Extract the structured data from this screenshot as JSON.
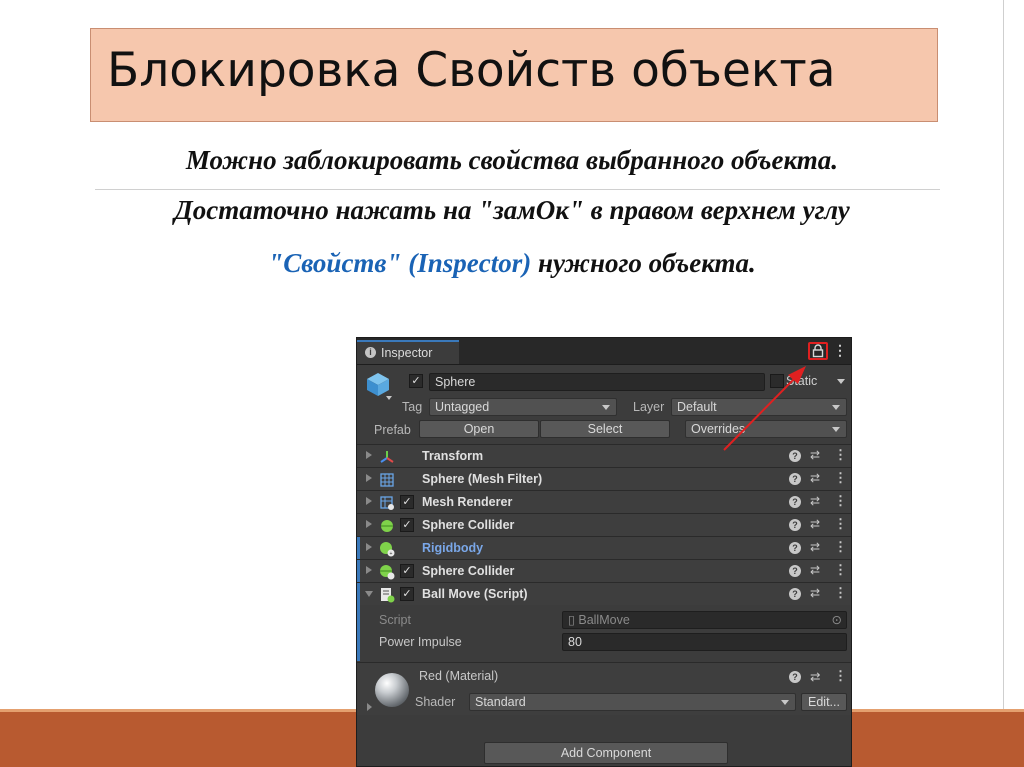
{
  "slide": {
    "title": "Блокировка Свойств объекта",
    "line1": "Можно заблокировать свойства выбранного объекта.",
    "line2": "Достаточно нажать на \"замОк\" в правом верхнем углу",
    "line3_highlight": "\"Свойств\" (Inspector)",
    "line3_rest": " нужного объекта."
  },
  "colors": {
    "title_bg": "#f6c7ad",
    "highlight": "#1a63b5",
    "bottom_bar": "#b85a30",
    "unity_bg": "#3c3c3c",
    "lock_highlight": "#e02020"
  },
  "inspector": {
    "tab_label": "Inspector",
    "object_name": "Sphere",
    "static_label": "Static",
    "tag_label": "Tag",
    "tag_value": "Untagged",
    "layer_label": "Layer",
    "layer_value": "Default",
    "prefab_label": "Prefab",
    "open_button": "Open",
    "select_button": "Select",
    "overrides_value": "Overrides",
    "components": [
      {
        "name": "Transform",
        "icon": "transform-icon"
      },
      {
        "name": "Sphere (Mesh Filter)",
        "icon": "mesh-filter-icon"
      },
      {
        "name": "Mesh Renderer",
        "icon": "mesh-renderer-icon",
        "enabled": true
      },
      {
        "name": "Sphere Collider",
        "icon": "sphere-collider-icon",
        "enabled": true
      },
      {
        "name": "Rigidbody",
        "icon": "rigidbody-icon"
      },
      {
        "name": "Sphere Collider",
        "icon": "sphere-collider-icon",
        "enabled": true
      },
      {
        "name": "Ball Move (Script)",
        "icon": "script-icon",
        "enabled": true
      }
    ],
    "script_label": "Script",
    "script_value": "BallMove",
    "power_label": "Power Impulse",
    "power_value": "80",
    "material_name": "Red (Material)",
    "shader_label": "Shader",
    "shader_value": "Standard",
    "edit_button": "Edit...",
    "add_component_button": "Add Component"
  }
}
